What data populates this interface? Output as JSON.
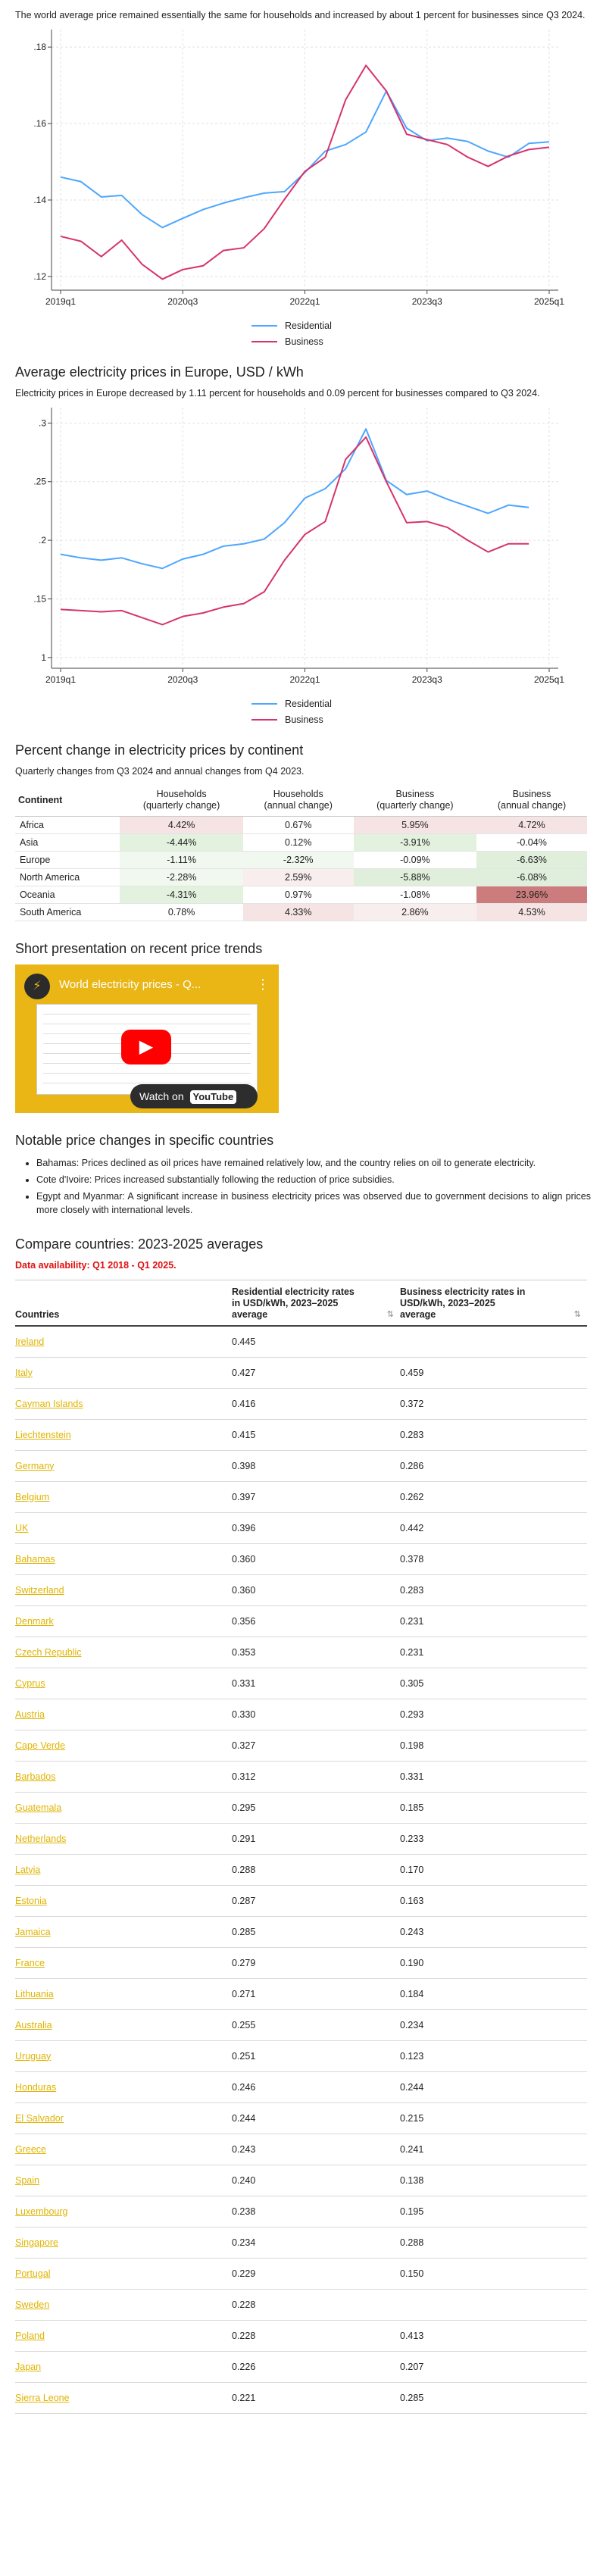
{
  "intro_text": "The world average price remained essentially the same for households and increased by about 1 percent for businesses since Q3 2024.",
  "chart1": {
    "chart_data": {
      "type": "line",
      "x": [
        "2019q1",
        "2019q2",
        "2019q3",
        "2019q4",
        "2020q1",
        "2020q2",
        "2020q3",
        "2020q4",
        "2021q1",
        "2021q2",
        "2021q3",
        "2021q4",
        "2022q1",
        "2022q2",
        "2022q3",
        "2022q4",
        "2023q1",
        "2023q2",
        "2023q3",
        "2023q4",
        "2024q1",
        "2024q2",
        "2024q3",
        "2024q4",
        "2025q1"
      ],
      "xticks": [
        "2019q1",
        "2020q3",
        "2022q1",
        "2023q3",
        "2025q1"
      ],
      "yticks": [
        ".12",
        ".14",
        ".16",
        ".18"
      ],
      "ylim": [
        0.118,
        0.183
      ],
      "series": [
        {
          "name": "Residential",
          "color": "#4da6ff",
          "values": [
            0.146,
            0.1448,
            0.1408,
            0.1412,
            0.1362,
            0.1328,
            0.1352,
            0.1375,
            0.1392,
            0.1406,
            0.1418,
            0.1422,
            0.1472,
            0.1528,
            0.1545,
            0.1578,
            0.1685,
            0.1588,
            0.1555,
            0.1562,
            0.1553,
            0.1528,
            0.1512,
            0.1548,
            0.1552
          ]
        },
        {
          "name": "Business",
          "color": "#d6336c",
          "values": [
            0.1305,
            0.1292,
            0.1252,
            0.1295,
            0.1232,
            0.1193,
            0.1218,
            0.1228,
            0.1268,
            0.1275,
            0.1325,
            0.1402,
            0.1475,
            0.1512,
            0.1662,
            0.1752,
            0.1685,
            0.1572,
            0.1558,
            0.1545,
            0.1512,
            0.1488,
            0.1515,
            0.1532,
            0.1538
          ]
        }
      ]
    },
    "legend": [
      "Residential",
      "Business"
    ]
  },
  "section_europe": {
    "title": "Average electricity prices in Europe, USD / kWh",
    "subtitle": "Electricity prices in Europe decreased by 1.11 percent for households and 0.09 percent for businesses compared to Q3 2024."
  },
  "chart2": {
    "chart_data": {
      "type": "line",
      "x": [
        "2019q1",
        "2019q2",
        "2019q3",
        "2019q4",
        "2020q1",
        "2020q2",
        "2020q3",
        "2020q4",
        "2021q1",
        "2021q2",
        "2021q3",
        "2021q4",
        "2022q1",
        "2022q2",
        "2022q3",
        "2022q4",
        "2023q1",
        "2023q2",
        "2023q3",
        "2023q4",
        "2024q1",
        "2024q2",
        "2024q3",
        "2024q4",
        "2025q1"
      ],
      "xticks": [
        "2019q1",
        "2020q3",
        "2022q1",
        "2023q3",
        "2025q1"
      ],
      "yticks": [
        "1",
        ".15",
        ".2",
        ".25",
        ".3"
      ],
      "ylim": [
        0.096,
        0.308
      ],
      "series": [
        {
          "name": "Residential",
          "color": "#4da6ff",
          "values": [
            0.188,
            0.185,
            0.183,
            0.185,
            0.18,
            0.176,
            0.184,
            0.188,
            0.195,
            0.197,
            0.201,
            0.215,
            0.236,
            0.244,
            0.261,
            0.295,
            0.251,
            0.239,
            0.242,
            0.235,
            0.229,
            0.223,
            0.23,
            0.228,
            null
          ]
        },
        {
          "name": "Business",
          "color": "#d6336c",
          "values": [
            0.141,
            0.14,
            0.139,
            0.14,
            0.134,
            0.128,
            0.135,
            0.138,
            0.143,
            0.146,
            0.156,
            0.183,
            0.205,
            0.216,
            0.269,
            0.288,
            0.25,
            0.215,
            0.216,
            0.211,
            0.2,
            0.19,
            0.197,
            0.197,
            null
          ]
        }
      ]
    },
    "legend": [
      "Residential",
      "Business"
    ]
  },
  "pct_section": {
    "title": "Percent change in electricity prices by continent",
    "subtitle": "Quarterly changes from Q3 2024 and annual changes from Q4 2023.",
    "headers": [
      "Continent",
      "Households\n(quarterly change)",
      "Households\n(annual change)",
      "Business\n(quarterly change)",
      "Business\n(annual change)"
    ],
    "rows": [
      {
        "name": "Africa",
        "v": [
          "4.42%",
          "0.67%",
          "5.95%",
          "4.72%"
        ],
        "bg": [
          "#f6e4e4",
          "#ffffff",
          "#f6e4e4",
          "#f6e4e4"
        ]
      },
      {
        "name": "Asia",
        "v": [
          "-4.44%",
          "0.12%",
          "-3.91%",
          "-0.04%"
        ],
        "bg": [
          "#e3f1df",
          "#ffffff",
          "#e3f1df",
          "#ffffff"
        ]
      },
      {
        "name": "Europe",
        "v": [
          "-1.11%",
          "-2.32%",
          "-0.09%",
          "-6.63%"
        ],
        "bg": [
          "#f1f8ef",
          "#f1f8ef",
          "#ffffff",
          "#e0efdb"
        ]
      },
      {
        "name": "North America",
        "v": [
          "-2.28%",
          "2.59%",
          "-5.88%",
          "-6.08%"
        ],
        "bg": [
          "#f1f8ef",
          "#f8eeee",
          "#e0efdb",
          "#e0efdb"
        ]
      },
      {
        "name": "Oceania",
        "v": [
          "-4.31%",
          "0.97%",
          "-1.08%",
          "23.96%"
        ],
        "bg": [
          "#e3f1df",
          "#ffffff",
          "#ffffff",
          "#cc7c7c"
        ]
      },
      {
        "name": "South America",
        "v": [
          "0.78%",
          "4.33%",
          "2.86%",
          "4.53%"
        ],
        "bg": [
          "#ffffff",
          "#f6e4e4",
          "#f8eeee",
          "#f6e4e4"
        ]
      }
    ]
  },
  "video_section": {
    "title": "Short presentation on recent price trends",
    "video_title": "World electricity prices - Q...",
    "watch_on": "Watch on",
    "youtube": "YouTube"
  },
  "notable": {
    "title": "Notable price changes in specific countries",
    "items": [
      "Bahamas: Prices declined as oil prices have remained relatively low, and the country relies on oil to generate electricity.",
      "Cote d'Ivoire: Prices increased substantially following the reduction of price subsidies.",
      "Egypt and Myanmar: A significant increase in business electricity prices was observed due to government decisions to align prices more closely with international levels."
    ]
  },
  "compare": {
    "title": "Compare countries: 2023-2025 averages",
    "availability": "Data availability: Q1 2018 - Q1 2025.",
    "headers": [
      "Countries",
      "Residential electricity rates in USD/kWh, 2023–2025 average",
      "Business electricity rates in USD/kWh, 2023–2025 average"
    ],
    "rows": [
      [
        "Ireland",
        "0.445",
        ""
      ],
      [
        "Italy",
        "0.427",
        "0.459"
      ],
      [
        "Cayman Islands",
        "0.416",
        "0.372"
      ],
      [
        "Liechtenstein",
        "0.415",
        "0.283"
      ],
      [
        "Germany",
        "0.398",
        "0.286"
      ],
      [
        "Belgium",
        "0.397",
        "0.262"
      ],
      [
        "UK",
        "0.396",
        "0.442"
      ],
      [
        "Bahamas",
        "0.360",
        "0.378"
      ],
      [
        "Switzerland",
        "0.360",
        "0.283"
      ],
      [
        "Denmark",
        "0.356",
        "0.231"
      ],
      [
        "Czech Republic",
        "0.353",
        "0.231"
      ],
      [
        "Cyprus",
        "0.331",
        "0.305"
      ],
      [
        "Austria",
        "0.330",
        "0.293"
      ],
      [
        "Cape Verde",
        "0.327",
        "0.198"
      ],
      [
        "Barbados",
        "0.312",
        "0.331"
      ],
      [
        "Guatemala",
        "0.295",
        "0.185"
      ],
      [
        "Netherlands",
        "0.291",
        "0.233"
      ],
      [
        "Latvia",
        "0.288",
        "0.170"
      ],
      [
        "Estonia",
        "0.287",
        "0.163"
      ],
      [
        "Jamaica",
        "0.285",
        "0.243"
      ],
      [
        "France",
        "0.279",
        "0.190"
      ],
      [
        "Lithuania",
        "0.271",
        "0.184"
      ],
      [
        "Australia",
        "0.255",
        "0.234"
      ],
      [
        "Uruguay",
        "0.251",
        "0.123"
      ],
      [
        "Honduras",
        "0.246",
        "0.244"
      ],
      [
        "El Salvador",
        "0.244",
        "0.215"
      ],
      [
        "Greece",
        "0.243",
        "0.241"
      ],
      [
        "Spain",
        "0.240",
        "0.138"
      ],
      [
        "Luxembourg",
        "0.238",
        "0.195"
      ],
      [
        "Singapore",
        "0.234",
        "0.288"
      ],
      [
        "Portugal",
        "0.229",
        "0.150"
      ],
      [
        "Sweden",
        "0.228",
        ""
      ],
      [
        "Poland",
        "0.228",
        "0.413"
      ],
      [
        "Japan",
        "0.226",
        "0.207"
      ],
      [
        "Sierra Leone",
        "0.221",
        "0.285"
      ]
    ]
  }
}
